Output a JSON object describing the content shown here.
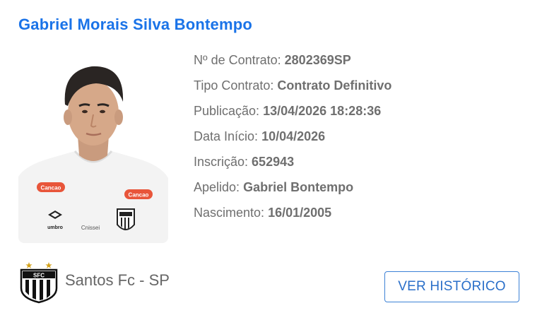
{
  "player": {
    "name": "Gabriel Morais Silva Bontempo"
  },
  "details": [
    {
      "label": "Nº de Contrato:",
      "value": "2802369SP"
    },
    {
      "label": "Tipo Contrato:",
      "value": "Contrato Definitivo"
    },
    {
      "label": "Publicação:",
      "value": "13/04/2026 18:28:36"
    },
    {
      "label": "Data Início:",
      "value": "10/04/2026"
    },
    {
      "label": "Inscrição:",
      "value": "652943"
    },
    {
      "label": "Apelido:",
      "value": "Gabriel Bontempo"
    },
    {
      "label": "Nascimento:",
      "value": "16/01/2005"
    }
  ],
  "club": {
    "name": "Santos Fc - SP",
    "logo_icon": "santos-crest-icon"
  },
  "photo": {
    "sponsor_text": "Cancao",
    "brand_text": "umbro",
    "sponsor2_text": "Cnissei"
  },
  "actions": {
    "history_label": "VER HISTÓRICO"
  },
  "colors": {
    "name": "#1a73e8",
    "text": "#6f6f6f",
    "button_border": "#3d82d6"
  }
}
